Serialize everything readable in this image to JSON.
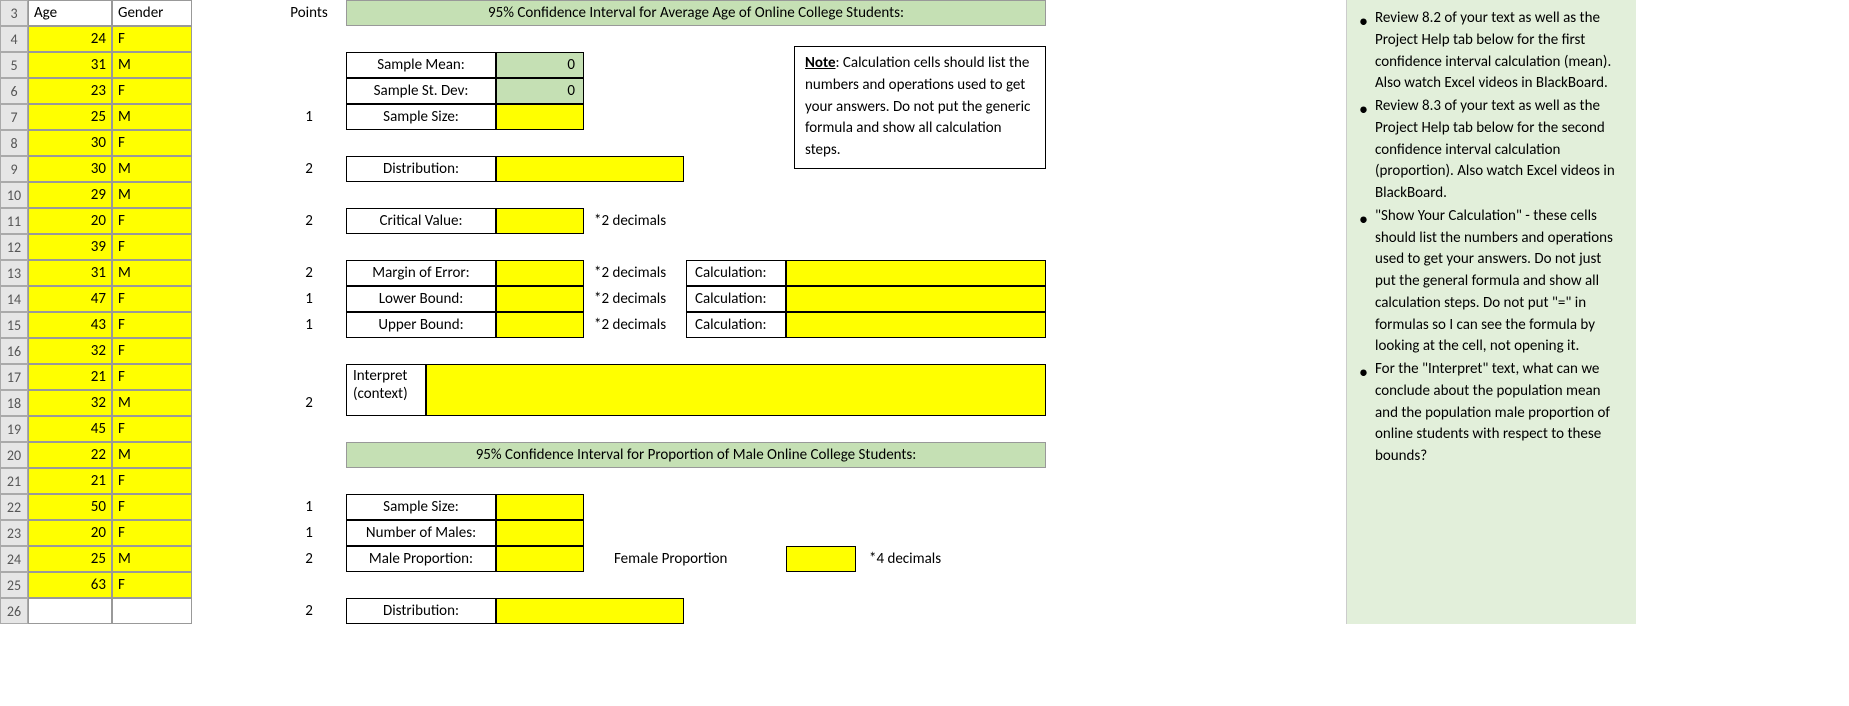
{
  "headers": {
    "age": "Age",
    "gender": "Gender",
    "points": "Points"
  },
  "rows": [
    {
      "r": "3",
      "age": "",
      "gender": ""
    },
    {
      "r": "4",
      "age": "24",
      "gender": "F"
    },
    {
      "r": "5",
      "age": "31",
      "gender": "M"
    },
    {
      "r": "6",
      "age": "23",
      "gender": "F"
    },
    {
      "r": "7",
      "age": "25",
      "gender": "M",
      "pts": "1"
    },
    {
      "r": "8",
      "age": "30",
      "gender": "F"
    },
    {
      "r": "9",
      "age": "30",
      "gender": "M",
      "pts": "2"
    },
    {
      "r": "10",
      "age": "29",
      "gender": "M"
    },
    {
      "r": "11",
      "age": "20",
      "gender": "F",
      "pts": "2"
    },
    {
      "r": "12",
      "age": "39",
      "gender": "F"
    },
    {
      "r": "13",
      "age": "31",
      "gender": "M",
      "pts": "2"
    },
    {
      "r": "14",
      "age": "47",
      "gender": "F",
      "pts": "1"
    },
    {
      "r": "15",
      "age": "43",
      "gender": "F",
      "pts": "1"
    },
    {
      "r": "16",
      "age": "32",
      "gender": "F"
    },
    {
      "r": "17",
      "age": "21",
      "gender": "F"
    },
    {
      "r": "18",
      "age": "32",
      "gender": "M",
      "pts": "2"
    },
    {
      "r": "19",
      "age": "45",
      "gender": "F"
    },
    {
      "r": "20",
      "age": "22",
      "gender": "M"
    },
    {
      "r": "21",
      "age": "21",
      "gender": "F"
    },
    {
      "r": "22",
      "age": "50",
      "gender": "F",
      "pts": "1"
    },
    {
      "r": "23",
      "age": "20",
      "gender": "F",
      "pts": "1"
    },
    {
      "r": "24",
      "age": "25",
      "gender": "M",
      "pts": "2"
    },
    {
      "r": "25",
      "age": "63",
      "gender": "F"
    },
    {
      "r": "26",
      "age": "",
      "gender": "",
      "pts": "2",
      "blank": true
    }
  ],
  "section1": {
    "title": "95% Confidence Interval for Average Age of Online College Students:",
    "sample_mean_lbl": "Sample Mean:",
    "sample_mean_val": "0",
    "sample_std_lbl": "Sample St. Dev:",
    "sample_std_val": "0",
    "sample_size_lbl": "Sample Size:",
    "dist_lbl": "Distribution:",
    "crit_lbl": "Critical Value:",
    "dec2": "*2 decimals",
    "moe_lbl": "Margin of Error:",
    "lb_lbl": "Lower Bound:",
    "ub_lbl": "Upper Bound:",
    "calc_lbl": "Calculation:",
    "interp1": "Interpret",
    "interp2": "(context)"
  },
  "note": {
    "bold": "Note",
    "text": ": Calculation cells should list the numbers and operations used to get your answers. Do not put the generic formula and show all calculation steps."
  },
  "section2": {
    "title": "95% Confidence Interval for Proportion of Male Online College Students:",
    "size_lbl": "Sample Size:",
    "males_lbl": "Number of Males:",
    "mprop_lbl": "Male Proportion:",
    "fprop_lbl": "Female Proportion",
    "dec4": "*4 decimals",
    "dist_lbl": "Distribution:"
  },
  "bullets": [
    "Review 8.2 of your text as well as the Project Help tab below for the first confidence interval calculation (mean). Also watch Excel videos in BlackBoard.",
    "Review 8.3 of your text as well as the Project Help tab below for the second confidence interval calculation (proportion). Also watch Excel videos in BlackBoard.",
    " \"Show Your Calculation\" - these cells should list the numbers and operations used to get your answers. Do not just put the general formula and show all calculation steps. Do not put \"=\" in formulas so I can see the formula by looking at the cell, not opening it.",
    "For the \"Interpret\" text, what can we conclude about the population mean and the population male proportion of online students with respect to these bounds?"
  ]
}
